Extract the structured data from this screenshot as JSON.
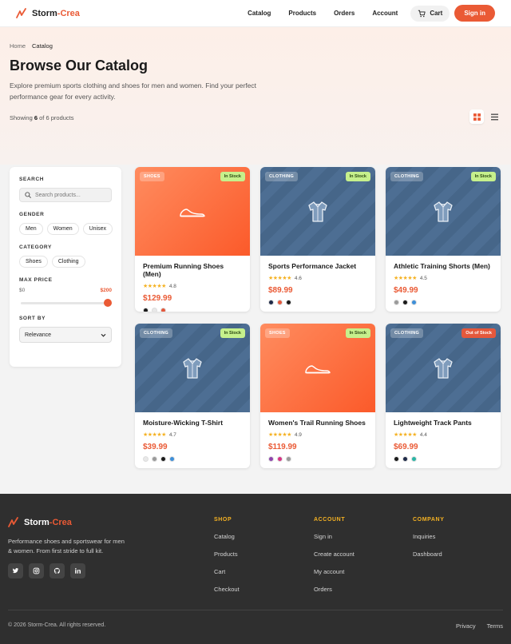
{
  "brand": {
    "name_part1": "Storm",
    "name_part2": "-Crea",
    "accent_color": "#ea5a35"
  },
  "nav": {
    "items": [
      "Catalog",
      "Products",
      "Orders",
      "Account"
    ],
    "cart_label": "Cart",
    "signin_label": "Sign in"
  },
  "breadcrumb": {
    "home": "Home",
    "current": "Catalog"
  },
  "hero": {
    "title": "Browse Our Catalog",
    "description": "Explore premium sports clothing and shoes for men and women. Find your perfect performance gear for every activity."
  },
  "results": {
    "prefix": "Showing",
    "shown": "6",
    "middle": "of 6 products"
  },
  "filters": {
    "search_label": "SEARCH",
    "search_placeholder": "Search products...",
    "gender_label": "GENDER",
    "gender_options": [
      "Men",
      "Women",
      "Unisex"
    ],
    "category_label": "CATEGORY",
    "category_options": [
      "Shoes",
      "Clothing"
    ],
    "max_price_label": "MAX PRICE",
    "price_min": "$0",
    "price_max": "$200",
    "price_level": 1.0,
    "sort_label": "SORT BY",
    "sort_value": "Relevance"
  },
  "products": [
    {
      "category": "SHOES",
      "stock": "In Stock",
      "name": "Premium Running Shoes (Men)",
      "rating": "4.8",
      "stars": 5,
      "price": "$129.99",
      "colors": [
        "#1a1a1a",
        "#e8e8e8",
        "#e4583c"
      ],
      "type": "shoes"
    },
    {
      "category": "CLOTHING",
      "stock": "In Stock",
      "name": "Sports Performance Jacket",
      "rating": "4.6",
      "stars": 4.5,
      "price": "$89.99",
      "colors": [
        "#1e2a48",
        "#e4583c",
        "#1a1a1a"
      ],
      "type": "clothing"
    },
    {
      "category": "CLOTHING",
      "stock": "In Stock",
      "name": "Athletic Training Shorts (Men)",
      "rating": "4.5",
      "stars": 4.5,
      "price": "$49.99",
      "colors": [
        "#9a9a9a",
        "#1a1a1a",
        "#3d8fd9"
      ],
      "type": "clothing"
    },
    {
      "category": "CLOTHING",
      "stock": "In Stock",
      "name": "Moisture-Wicking T-Shirt",
      "rating": "4.7",
      "stars": 4.5,
      "price": "$39.99",
      "colors": [
        "#e8e8e8",
        "#9a9a9a",
        "#1a1a1a",
        "#3d8fd9"
      ],
      "type": "clothing"
    },
    {
      "category": "SHOES",
      "stock": "In Stock",
      "name": "Women's Trail Running Shoes",
      "rating": "4.9",
      "stars": 5,
      "price": "$119.99",
      "colors": [
        "#8e44ad",
        "#d63384",
        "#9a9a9a"
      ],
      "type": "shoes"
    },
    {
      "category": "CLOTHING",
      "stock": "Out of Stock",
      "name": "Lightweight Track Pants",
      "rating": "4.4",
      "stars": 4.5,
      "price": "$69.99",
      "colors": [
        "#1a1a1a",
        "#1e2a48",
        "#2ab5a5"
      ],
      "type": "clothing"
    }
  ],
  "footer": {
    "description": "Performance shoes and sportswear for men & women. From first stride to full kit.",
    "socials": [
      "twitter-icon",
      "instagram-icon",
      "github-icon",
      "linkedin-icon"
    ],
    "columns": [
      {
        "title": "SHOP",
        "links": [
          "Catalog",
          "Products",
          "Cart",
          "Checkout"
        ]
      },
      {
        "title": "ACCOUNT",
        "links": [
          "Sign in",
          "Create account",
          "My account",
          "Orders"
        ]
      },
      {
        "title": "COMPANY",
        "links": [
          "Inquiries",
          "Dashboard"
        ]
      }
    ],
    "copyright": "© 2026 Storm-Crea. All rights reserved.",
    "legal": [
      "Privacy",
      "Terms"
    ]
  }
}
